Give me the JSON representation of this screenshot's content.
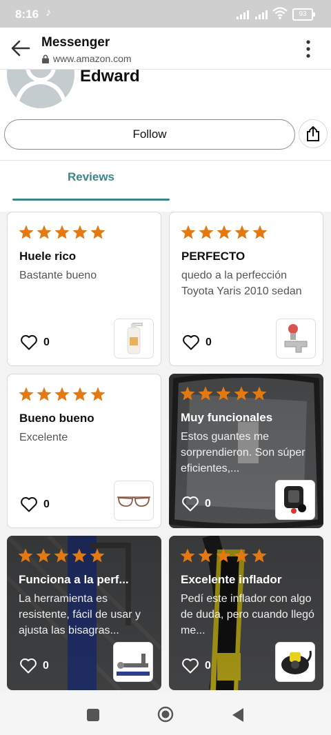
{
  "status": {
    "time": "8:16",
    "battery": "93"
  },
  "appbar": {
    "title": "Messenger",
    "url": "www.amazon.com"
  },
  "profile": {
    "name": "Edward",
    "follow_label": "Follow"
  },
  "tabs": [
    {
      "label": "Reviews",
      "active": true
    }
  ],
  "reviews": [
    {
      "stars": 5,
      "title": "Huele rico",
      "body": "Bastante bueno",
      "likes": "0",
      "product_icon": "lotion-bottle"
    },
    {
      "stars": 5,
      "title": "PERFECTO",
      "body": "quedo a la perfección Toyota Yaris 2010 sedan",
      "likes": "0",
      "product_icon": "faucet-tap"
    },
    {
      "stars": 5,
      "title": "Bueno bueno",
      "body": "Excelente",
      "likes": "0",
      "product_icon": "eyeglasses"
    },
    {
      "stars": 5,
      "title": "Muy funcionales",
      "body": "Estos guantes me sorprendieron. Son súper eficientes,...",
      "likes": "0",
      "product_icon": "gloves-pack"
    },
    {
      "stars": 5,
      "title": "Funciona a la perf...",
      "body": "La herramienta es resistente, fácil de usar y ajusta las bisagras...",
      "likes": "0",
      "product_icon": "hinge-tool"
    },
    {
      "stars": 5,
      "title": "Excelente inflador",
      "body": "Pedí este inflador con algo de duda, pero cuando llegó me...",
      "likes": "0",
      "product_icon": "air-pump"
    }
  ],
  "colors": {
    "star": "#e47911",
    "accent": "#3b8787",
    "statusbar": "#cfcfcf"
  }
}
